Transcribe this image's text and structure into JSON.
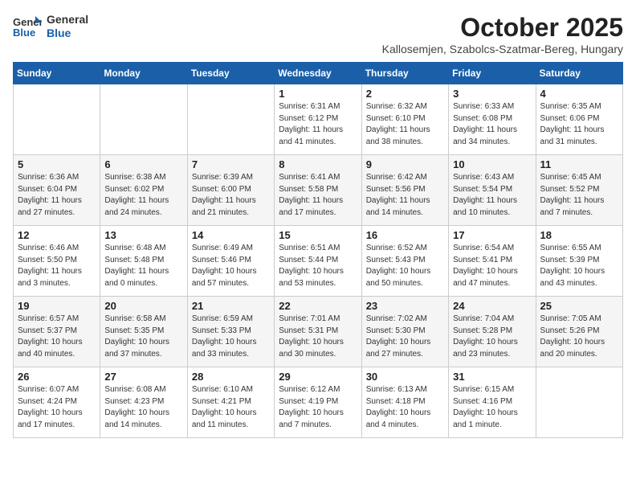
{
  "logo": {
    "text_general": "General",
    "text_blue": "Blue"
  },
  "header": {
    "month": "October 2025",
    "location": "Kallosemjen, Szabolcs-Szatmar-Bereg, Hungary"
  },
  "days_of_week": [
    "Sunday",
    "Monday",
    "Tuesday",
    "Wednesday",
    "Thursday",
    "Friday",
    "Saturday"
  ],
  "weeks": [
    [
      {
        "day": "",
        "info": ""
      },
      {
        "day": "",
        "info": ""
      },
      {
        "day": "",
        "info": ""
      },
      {
        "day": "1",
        "info": "Sunrise: 6:31 AM\nSunset: 6:12 PM\nDaylight: 11 hours\nand 41 minutes."
      },
      {
        "day": "2",
        "info": "Sunrise: 6:32 AM\nSunset: 6:10 PM\nDaylight: 11 hours\nand 38 minutes."
      },
      {
        "day": "3",
        "info": "Sunrise: 6:33 AM\nSunset: 6:08 PM\nDaylight: 11 hours\nand 34 minutes."
      },
      {
        "day": "4",
        "info": "Sunrise: 6:35 AM\nSunset: 6:06 PM\nDaylight: 11 hours\nand 31 minutes."
      }
    ],
    [
      {
        "day": "5",
        "info": "Sunrise: 6:36 AM\nSunset: 6:04 PM\nDaylight: 11 hours\nand 27 minutes."
      },
      {
        "day": "6",
        "info": "Sunrise: 6:38 AM\nSunset: 6:02 PM\nDaylight: 11 hours\nand 24 minutes."
      },
      {
        "day": "7",
        "info": "Sunrise: 6:39 AM\nSunset: 6:00 PM\nDaylight: 11 hours\nand 21 minutes."
      },
      {
        "day": "8",
        "info": "Sunrise: 6:41 AM\nSunset: 5:58 PM\nDaylight: 11 hours\nand 17 minutes."
      },
      {
        "day": "9",
        "info": "Sunrise: 6:42 AM\nSunset: 5:56 PM\nDaylight: 11 hours\nand 14 minutes."
      },
      {
        "day": "10",
        "info": "Sunrise: 6:43 AM\nSunset: 5:54 PM\nDaylight: 11 hours\nand 10 minutes."
      },
      {
        "day": "11",
        "info": "Sunrise: 6:45 AM\nSunset: 5:52 PM\nDaylight: 11 hours\nand 7 minutes."
      }
    ],
    [
      {
        "day": "12",
        "info": "Sunrise: 6:46 AM\nSunset: 5:50 PM\nDaylight: 11 hours\nand 3 minutes."
      },
      {
        "day": "13",
        "info": "Sunrise: 6:48 AM\nSunset: 5:48 PM\nDaylight: 11 hours\nand 0 minutes."
      },
      {
        "day": "14",
        "info": "Sunrise: 6:49 AM\nSunset: 5:46 PM\nDaylight: 10 hours\nand 57 minutes."
      },
      {
        "day": "15",
        "info": "Sunrise: 6:51 AM\nSunset: 5:44 PM\nDaylight: 10 hours\nand 53 minutes."
      },
      {
        "day": "16",
        "info": "Sunrise: 6:52 AM\nSunset: 5:43 PM\nDaylight: 10 hours\nand 50 minutes."
      },
      {
        "day": "17",
        "info": "Sunrise: 6:54 AM\nSunset: 5:41 PM\nDaylight: 10 hours\nand 47 minutes."
      },
      {
        "day": "18",
        "info": "Sunrise: 6:55 AM\nSunset: 5:39 PM\nDaylight: 10 hours\nand 43 minutes."
      }
    ],
    [
      {
        "day": "19",
        "info": "Sunrise: 6:57 AM\nSunset: 5:37 PM\nDaylight: 10 hours\nand 40 minutes."
      },
      {
        "day": "20",
        "info": "Sunrise: 6:58 AM\nSunset: 5:35 PM\nDaylight: 10 hours\nand 37 minutes."
      },
      {
        "day": "21",
        "info": "Sunrise: 6:59 AM\nSunset: 5:33 PM\nDaylight: 10 hours\nand 33 minutes."
      },
      {
        "day": "22",
        "info": "Sunrise: 7:01 AM\nSunset: 5:31 PM\nDaylight: 10 hours\nand 30 minutes."
      },
      {
        "day": "23",
        "info": "Sunrise: 7:02 AM\nSunset: 5:30 PM\nDaylight: 10 hours\nand 27 minutes."
      },
      {
        "day": "24",
        "info": "Sunrise: 7:04 AM\nSunset: 5:28 PM\nDaylight: 10 hours\nand 23 minutes."
      },
      {
        "day": "25",
        "info": "Sunrise: 7:05 AM\nSunset: 5:26 PM\nDaylight: 10 hours\nand 20 minutes."
      }
    ],
    [
      {
        "day": "26",
        "info": "Sunrise: 6:07 AM\nSunset: 4:24 PM\nDaylight: 10 hours\nand 17 minutes."
      },
      {
        "day": "27",
        "info": "Sunrise: 6:08 AM\nSunset: 4:23 PM\nDaylight: 10 hours\nand 14 minutes."
      },
      {
        "day": "28",
        "info": "Sunrise: 6:10 AM\nSunset: 4:21 PM\nDaylight: 10 hours\nand 11 minutes."
      },
      {
        "day": "29",
        "info": "Sunrise: 6:12 AM\nSunset: 4:19 PM\nDaylight: 10 hours\nand 7 minutes."
      },
      {
        "day": "30",
        "info": "Sunrise: 6:13 AM\nSunset: 4:18 PM\nDaylight: 10 hours\nand 4 minutes."
      },
      {
        "day": "31",
        "info": "Sunrise: 6:15 AM\nSunset: 4:16 PM\nDaylight: 10 hours\nand 1 minute."
      },
      {
        "day": "",
        "info": ""
      }
    ]
  ]
}
